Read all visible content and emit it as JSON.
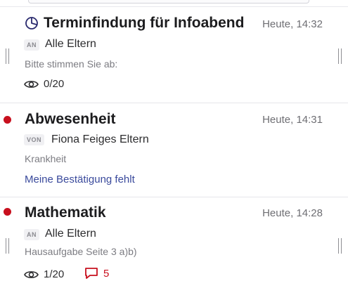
{
  "messages": [
    {
      "title": "Terminfindung für Infoabend",
      "time": "Heute, 14:32",
      "recipient_badge": "AN",
      "recipient": "Alle Eltern",
      "preview": "Bitte stimmen Sie ab:",
      "views": "0/20",
      "icon": "poll-icon"
    },
    {
      "title": "Abwesenheit",
      "time": "Heute, 14:31",
      "recipient_badge": "VON",
      "recipient": "Fiona Feiges Eltern",
      "preview": "Krankheit",
      "action_link": "Meine Bestätigung fehlt",
      "unread": true
    },
    {
      "title": "Mathematik",
      "time": "Heute, 14:28",
      "recipient_badge": "AN",
      "recipient": "Alle Eltern",
      "preview": "Hausaufgabe Seite 3 a)b)",
      "views": "1/20",
      "comments": "5",
      "unread": true
    }
  ],
  "colors": {
    "unread_dot": "#c8101e",
    "link": "#3a4a9c",
    "comment": "#c8101e",
    "secondary_text": "#7c7c82",
    "time_text": "#6e6e73"
  }
}
